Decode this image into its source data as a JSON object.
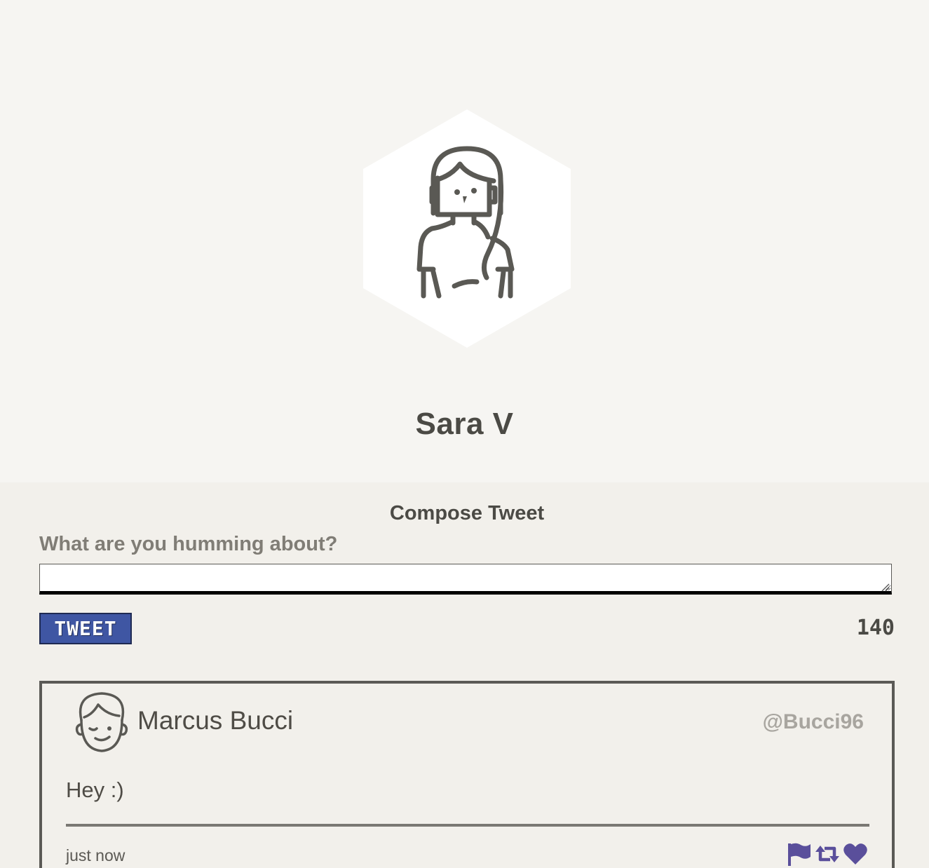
{
  "profile": {
    "name": "Sara V",
    "avatar_icon": "woman-avatar-icon"
  },
  "compose": {
    "title": "Compose Tweet",
    "prompt": "What are you humming about?",
    "input_value": "",
    "button_label": "TWEET",
    "char_count": "140"
  },
  "tweets": [
    {
      "author": "Marcus Bucci",
      "handle": "@Bucci96",
      "text": "Hey :)",
      "time": "just now",
      "avatar_icon": "man-avatar-icon",
      "actions": [
        "flag-icon",
        "retweet-icon",
        "heart-icon"
      ]
    }
  ],
  "colors": {
    "accent": "#3f56a3",
    "action_icon": "#5a4f9b",
    "page_bg": "#f2f0eb",
    "hero_bg": "#f6f5f2"
  }
}
